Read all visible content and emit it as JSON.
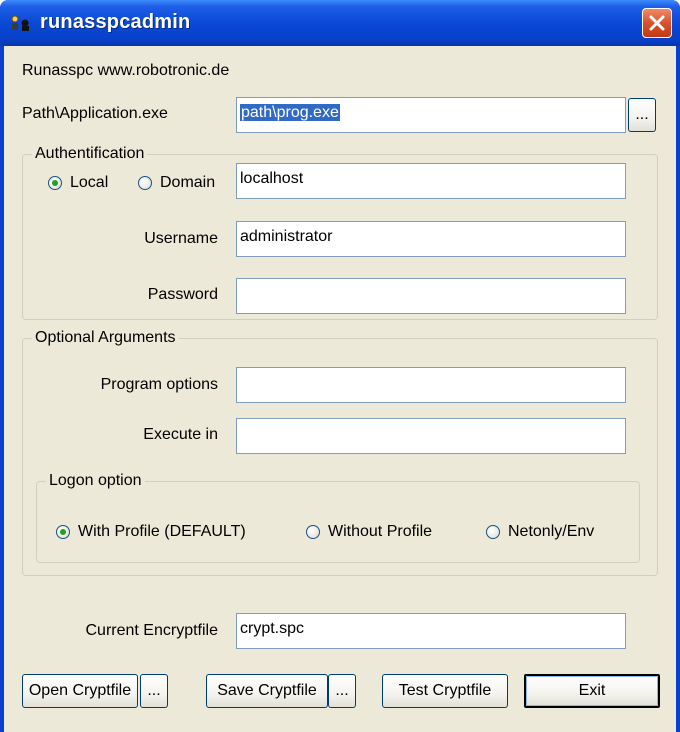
{
  "window": {
    "title": "runasspcadmin",
    "close_label": "close"
  },
  "header": {
    "info_text": "Runasspc www.robotronic.de"
  },
  "path": {
    "label": "Path\\Application.exe",
    "value": "path\\prog.exe",
    "browse_label": "..."
  },
  "auth": {
    "group_title": "Authentification",
    "local_label": "Local",
    "domain_label": "Domain",
    "selected": "Local",
    "domain_value": "localhost",
    "username_label": "Username",
    "username_value": "administrator",
    "password_label": "Password",
    "password_value": ""
  },
  "optional": {
    "group_title": "Optional Arguments",
    "program_options_label": "Program options",
    "program_options_value": "",
    "execute_in_label": "Execute in",
    "execute_in_value": ""
  },
  "logon": {
    "group_title": "Logon option",
    "options": [
      "With Profile (DEFAULT)",
      "Without Profile",
      "Netonly/Env"
    ],
    "selected": "With Profile (DEFAULT)"
  },
  "encrypt": {
    "label": "Current Encryptfile",
    "value": "crypt.spc"
  },
  "buttons": {
    "open": "Open Cryptfile",
    "open_browse": "...",
    "save": "Save Cryptfile",
    "save_browse": "...",
    "test": "Test Cryptfile",
    "exit": "Exit"
  },
  "colors": {
    "titlebar": "#0a49d6",
    "dialog_bg": "#ece9d8",
    "selection": "#316ac5",
    "radio_checked": "#21a121",
    "close_button": "#d9512c"
  }
}
